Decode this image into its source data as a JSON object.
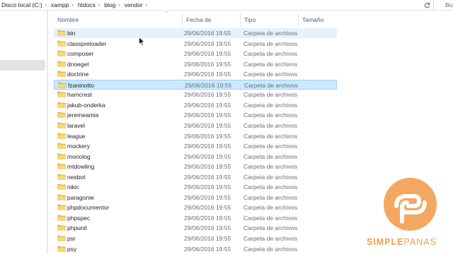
{
  "breadcrumb": [
    "Disco local (C:)",
    "xampp",
    "htdocs",
    "blog",
    "vendor"
  ],
  "search": {
    "label": "Bus"
  },
  "columns": {
    "name": "Nombre",
    "date": "Fecha de modifica...",
    "type": "Tipo",
    "size": "Tamaño"
  },
  "rows": [
    {
      "name": "bin",
      "date": "29/06/2016 19:55",
      "type": "Carpeta de archivos",
      "state": "hover"
    },
    {
      "name": "classpreloader",
      "date": "29/06/2016 19:55",
      "type": "Carpeta de archivos"
    },
    {
      "name": "composer",
      "date": "29/06/2016 19:55",
      "type": "Carpeta de archivos"
    },
    {
      "name": "dnoegel",
      "date": "29/06/2016 19:55",
      "type": "Carpeta de archivos"
    },
    {
      "name": "doctrine",
      "date": "29/06/2016 19:55",
      "type": "Carpeta de archivos"
    },
    {
      "name": "fzaninotto",
      "date": "29/06/2016 19:55",
      "type": "Carpeta de archivos",
      "state": "selected"
    },
    {
      "name": "hamcrest",
      "date": "29/06/2016 19:55",
      "type": "Carpeta de archivos"
    },
    {
      "name": "jakub-onderka",
      "date": "29/06/2016 19:55",
      "type": "Carpeta de archivos"
    },
    {
      "name": "jeremeamia",
      "date": "29/06/2016 19:55",
      "type": "Carpeta de archivos"
    },
    {
      "name": "laravel",
      "date": "29/06/2016 19:55",
      "type": "Carpeta de archivos"
    },
    {
      "name": "league",
      "date": "29/06/2016 19:55",
      "type": "Carpeta de archivos"
    },
    {
      "name": "mockery",
      "date": "29/06/2016 19:55",
      "type": "Carpeta de archivos"
    },
    {
      "name": "monolog",
      "date": "29/06/2016 19:55",
      "type": "Carpeta de archivos"
    },
    {
      "name": "mtdowling",
      "date": "29/06/2016 19:55",
      "type": "Carpeta de archivos"
    },
    {
      "name": "nesbot",
      "date": "29/06/2016 19:55",
      "type": "Carpeta de archivos"
    },
    {
      "name": "nikic",
      "date": "29/06/2016 19:55",
      "type": "Carpeta de archivos"
    },
    {
      "name": "paragonie",
      "date": "29/06/2016 19:55",
      "type": "Carpeta de archivos"
    },
    {
      "name": "phpdocumentor",
      "date": "29/06/2016 19:55",
      "type": "Carpeta de archivos"
    },
    {
      "name": "phpspec",
      "date": "29/06/2016 19:55",
      "type": "Carpeta de archivos"
    },
    {
      "name": "phpunit",
      "date": "29/06/2016 19:55",
      "type": "Carpeta de archivos"
    },
    {
      "name": "psr",
      "date": "29/06/2016 19:55",
      "type": "Carpeta de archivos"
    },
    {
      "name": "psy",
      "date": "29/06/2016 19:55",
      "type": "Carpeta de archivos"
    }
  ],
  "watermark": {
    "brand_bold": "SIMPLE",
    "brand_light": "PANAS",
    "color": "#f39c4c"
  },
  "colors": {
    "hover": "#e5f1fb",
    "selected": "#cce8ff",
    "folder": "#f6d26b",
    "header_text": "#4c607a"
  },
  "icons": {
    "folder": "folder-icon",
    "refresh": "refresh-icon",
    "cursor": "mouse-pointer-icon"
  }
}
